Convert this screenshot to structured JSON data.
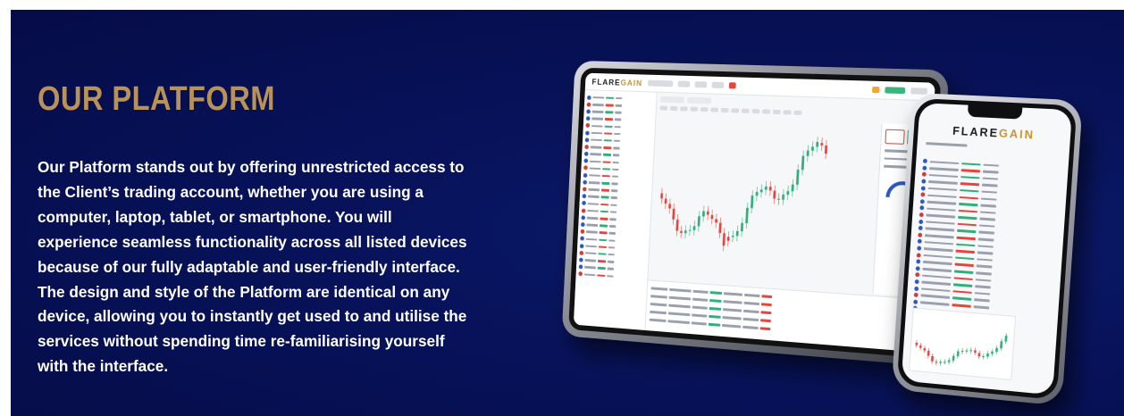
{
  "section": {
    "heading": "OUR PLATFORM",
    "body": "Our Platform stands out by offering unrestricted access to the Client’s trading account, whether you are using a computer, laptop, tablet, or smartphone. You will experience seamless functionality across all listed devices because of our fully adaptable and user-friendly interface. The design and style of the Platform are identical on any device, allowing you to instantly get used to and utilise the services without spending time re-familiarising yourself with the interface."
  },
  "devices": {
    "tablet_logo": [
      "FLARE",
      "GAIN"
    ],
    "phone_logo": [
      "FLARE",
      "GAIN"
    ]
  },
  "colors": {
    "background": "#050c47",
    "heading": "#b89257",
    "body_text": "#ffffff",
    "brand_gold": "#c5942f",
    "candle_up": "#2fb07a",
    "candle_down": "#e4463c"
  }
}
